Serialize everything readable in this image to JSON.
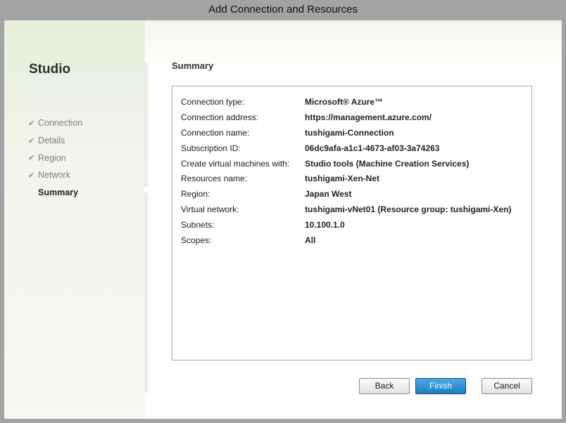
{
  "window": {
    "title": "Add Connection and Resources"
  },
  "sidebar": {
    "brand": "Studio",
    "steps": [
      {
        "label": "Connection",
        "completed": true
      },
      {
        "label": "Details",
        "completed": true
      },
      {
        "label": "Region",
        "completed": true
      },
      {
        "label": "Network",
        "completed": true
      },
      {
        "label": "Summary",
        "completed": false,
        "active": true
      }
    ],
    "check_icon": "✔"
  },
  "main": {
    "section_title": "Summary",
    "rows": [
      {
        "key": "Connection type:",
        "value": "Microsoft® Azure™"
      },
      {
        "key": "Connection address:",
        "value": "https://management.azure.com/"
      },
      {
        "key": "Connection name:",
        "value": "tushigami-Connection"
      },
      {
        "key": "Subscription ID:",
        "value": "06dc9afa-a1c1-4673-af03-3a74263"
      },
      {
        "key": "Create virtual machines with:",
        "value": "Studio tools (Machine Creation Services)"
      },
      {
        "key": "Resources name:",
        "value": "tushigami-Xen-Net"
      },
      {
        "key": "Region:",
        "value": "Japan West"
      },
      {
        "key": "Virtual network:",
        "value": "tushigami-vNet01 (Resource group: tushigami-Xen)"
      },
      {
        "key": "Subnets:",
        "value": "10.100.1.0"
      },
      {
        "key": "Scopes:",
        "value": "All"
      }
    ]
  },
  "buttons": {
    "back": "Back",
    "finish": "Finish",
    "cancel": "Cancel"
  },
  "colors": {
    "accent": "#1d7fc4",
    "background": "#a3a3a3"
  }
}
